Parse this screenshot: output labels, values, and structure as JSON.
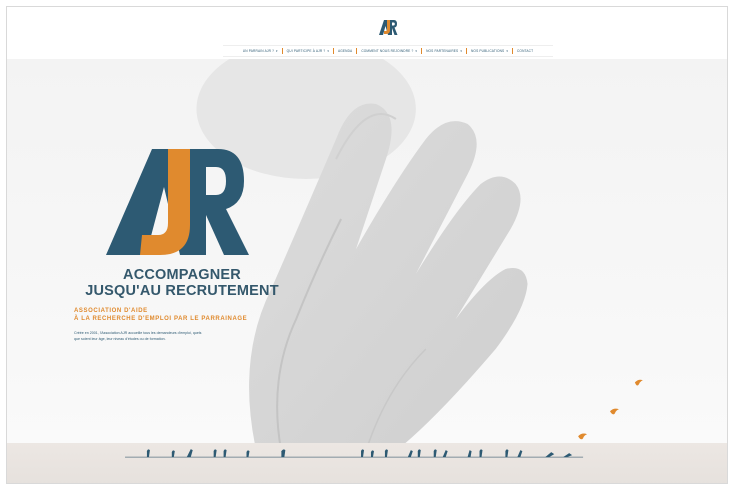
{
  "header": {
    "logo_text": "AJR",
    "nav": [
      {
        "label": "UN PARRAIN AJR ?",
        "has_caret": true
      },
      {
        "label": "QUI PARTICIPE À AJR ?",
        "has_caret": true
      },
      {
        "label": "AGENDA",
        "has_caret": false
      },
      {
        "label": "COMMENT NOUS REJOINDRE ?",
        "has_caret": true
      },
      {
        "label": "NOS PARTENAIRES",
        "has_caret": true
      },
      {
        "label": "NOS PUBLICATIONS",
        "has_caret": true
      },
      {
        "label": "CONTACT",
        "has_caret": false
      }
    ]
  },
  "hero": {
    "logo_text": "AJR",
    "tagline_line1": "ACCOMPAGNER",
    "tagline_line2": "JUSQU'AU RECRUTEMENT",
    "assoc_line1": "ASSOCIATION D'AIDE",
    "assoc_line2": "À LA RECHERCHE D'EMPLOI PAR LE PARRAINAGE",
    "description": "Créée en 2001, l'Association AJR accueille tous les demandeurs d'emploi, quels que soient leur âge, leur niveau d'études ou de formation."
  },
  "colors": {
    "brand_blue": "#2d5a73",
    "brand_orange": "#e08a2e"
  }
}
